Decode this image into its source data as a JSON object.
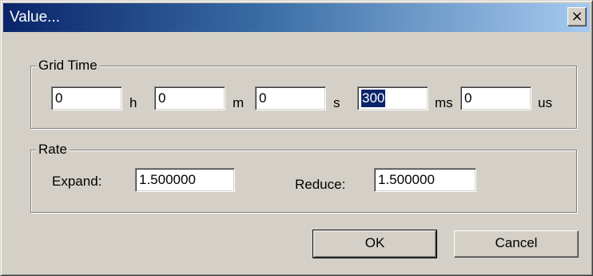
{
  "window": {
    "title": "Value...",
    "close_label": "×"
  },
  "grid_time": {
    "legend": "Grid Time",
    "fields": [
      {
        "value": "0",
        "unit": "h"
      },
      {
        "value": "0",
        "unit": "m"
      },
      {
        "value": "0",
        "unit": "s"
      },
      {
        "value": "300",
        "unit": "ms"
      },
      {
        "value": "0",
        "unit": "us"
      }
    ]
  },
  "rate": {
    "legend": "Rate",
    "expand_label": "Expand:",
    "expand_value": "1.500000",
    "reduce_label": "Reduce:",
    "reduce_value": "1.500000"
  },
  "buttons": {
    "ok_label": "OK",
    "cancel_label": "Cancel"
  },
  "colors": {
    "titlebar_start": "#0a246a",
    "titlebar_end": "#a6caf0",
    "dialog_face": "#d4d0c8",
    "selection": "#0a246a"
  }
}
